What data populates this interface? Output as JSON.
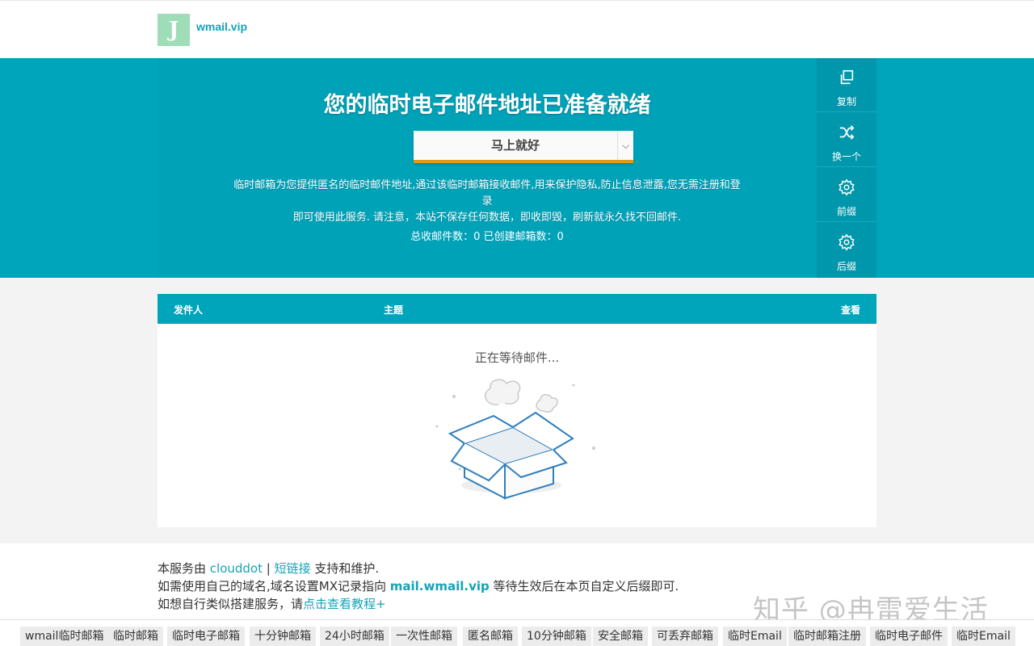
{
  "header": {
    "brand": "wmail.vip",
    "logo_glyph": "J"
  },
  "hero": {
    "title": "您的临时电子邮件地址已准备就绪",
    "address_value": "马上就好",
    "desc_line1": "临时邮箱为您提供匿名的临时邮件地址,通过该临时邮箱接收邮件,用来保护隐私,防止信息泄露,您无需注册和登录",
    "desc_line2": "即可使用此服务. 请注意，本站不保存任何数据，即收即毁，刷新就永久找不回邮件.",
    "stats": "总收邮件数：0 已创建邮箱数：0"
  },
  "actions": [
    {
      "label": "复制",
      "icon": "copy-icon"
    },
    {
      "label": "换一个",
      "icon": "shuffle-icon"
    },
    {
      "label": "前缀",
      "icon": "gear-icon"
    },
    {
      "label": "后缀",
      "icon": "gear-icon"
    }
  ],
  "table": {
    "col_sender": "发件人",
    "col_subject": "主题",
    "col_view": "查看",
    "waiting": "正在等待邮件..."
  },
  "footer": {
    "line1_pre": "本服务由 ",
    "line1_link1": "clouddot",
    "line1_sep": " | ",
    "line1_link2": "短链接",
    "line1_post": " 支持和维护.",
    "line2_pre": "如需使用自己的域名,域名设置MX记录指向 ",
    "line2_link": "mail.wmail.vip",
    "line2_post": " 等待生效后在本页自定义后缀即可.",
    "line3_pre": "如想自行类似搭建服务，请",
    "line3_link": "点击查看教程+"
  },
  "watermark": "知乎 @冉雷爱生活",
  "tags": [
    "wmail临时邮箱",
    "临时邮箱",
    "临时电子邮箱",
    "十分钟邮箱",
    "24小时邮箱",
    "一次性邮箱",
    "匿名邮箱",
    "10分钟邮箱",
    "安全邮箱",
    "可丢弃邮箱",
    "临时Email",
    "临时邮箱注册",
    "临时电子邮件",
    "临时Email"
  ],
  "colors": {
    "accent": "#00a5bb",
    "brand_text": "#15a3b7",
    "underline": "#e09a1a"
  }
}
